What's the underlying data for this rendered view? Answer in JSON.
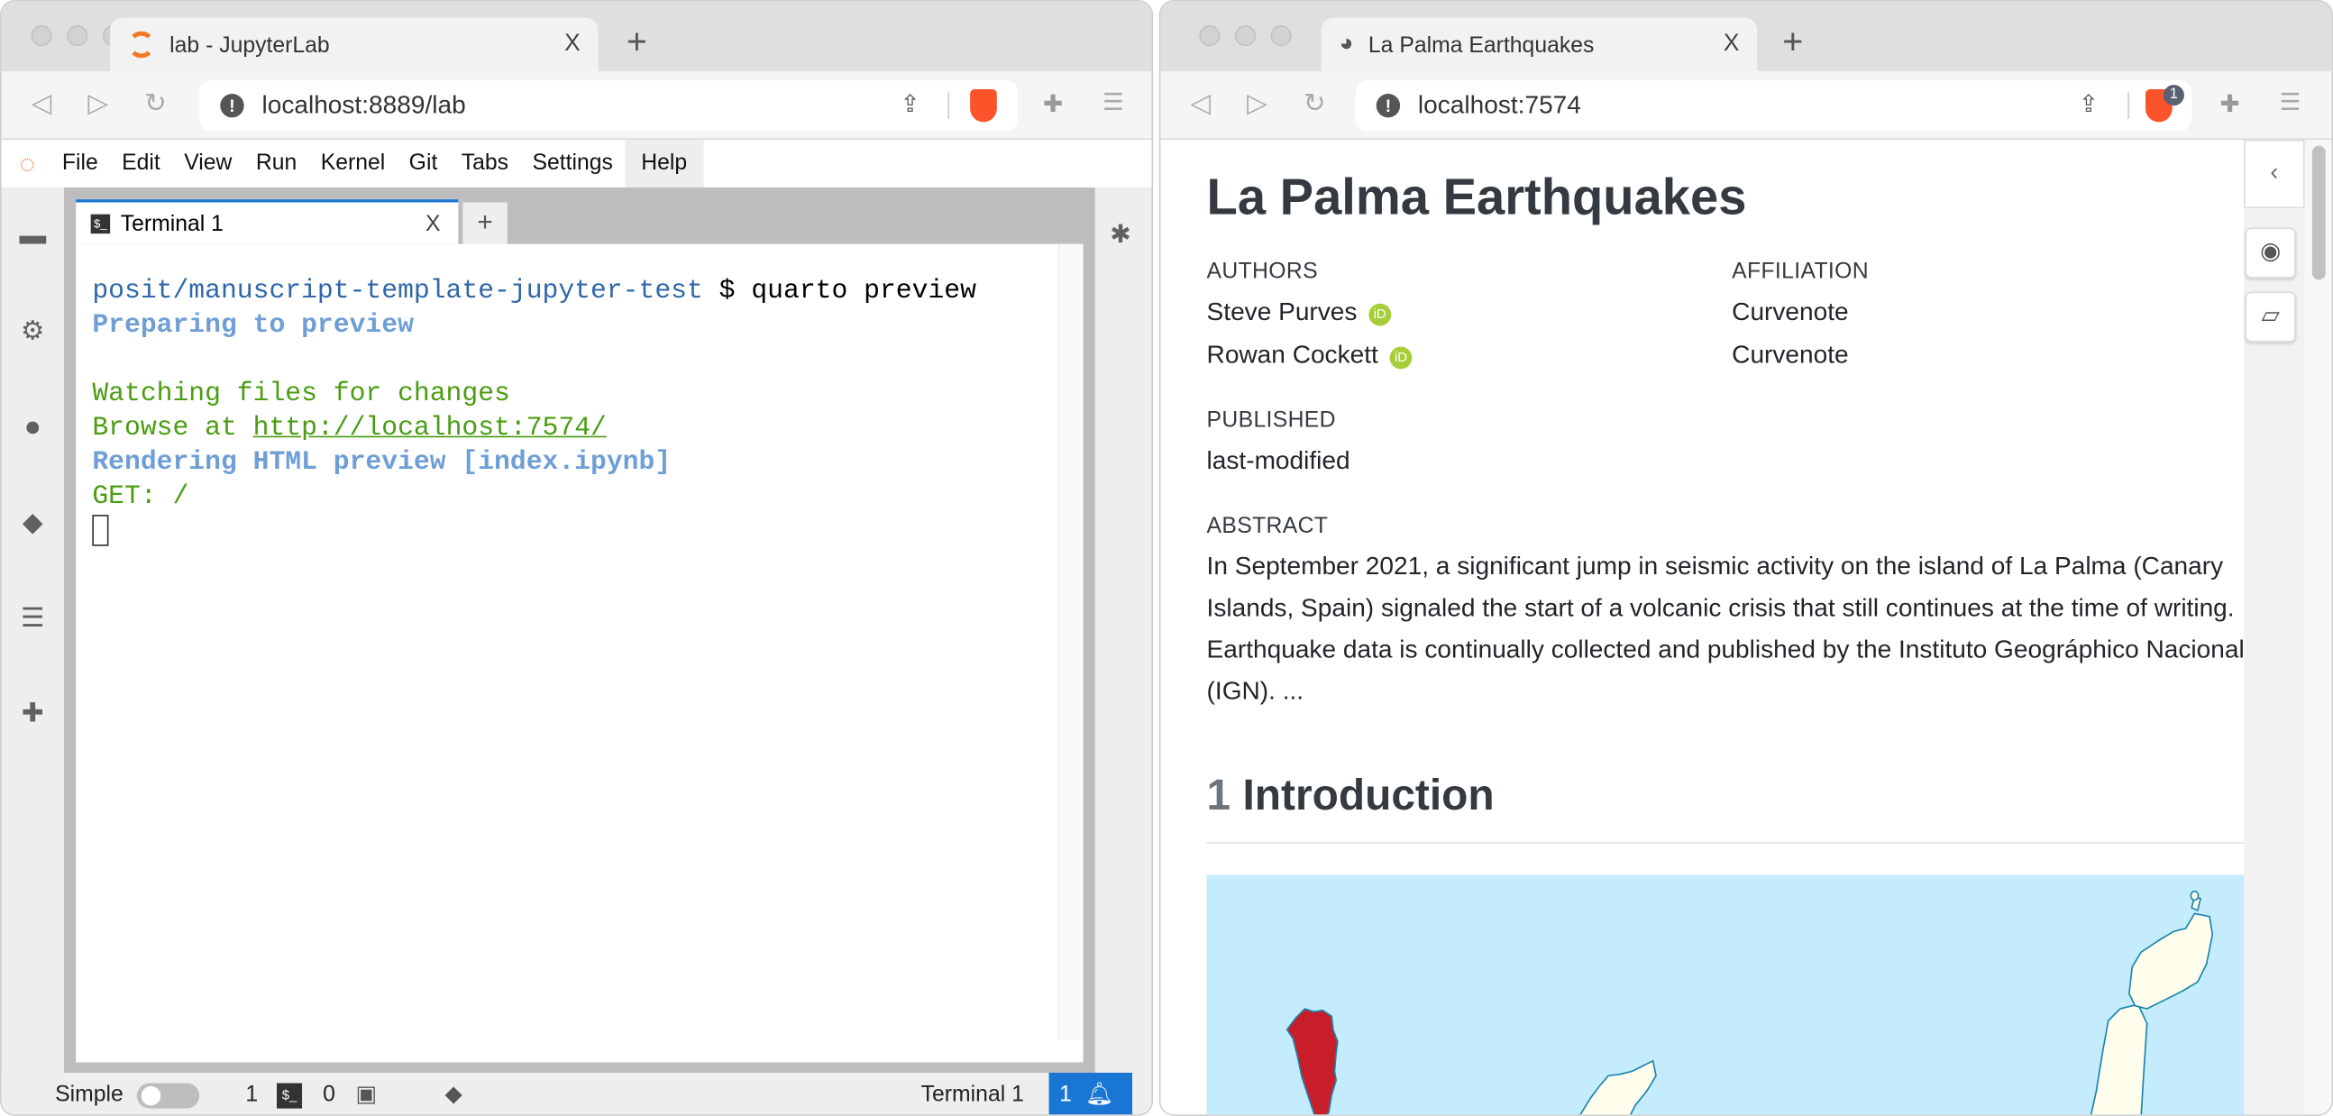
{
  "left_window": {
    "tab_title": "lab - JupyterLab",
    "tab_close": "X",
    "new_tab": "+",
    "url": "localhost:8889/lab",
    "menu": [
      "File",
      "Edit",
      "View",
      "Run",
      "Kernel",
      "Git",
      "Tabs",
      "Settings",
      "Help"
    ],
    "active_menu": "Help",
    "doc_tab": {
      "label": "Terminal 1",
      "close": "X",
      "add": "+"
    },
    "sidebar_icons": [
      "folder-icon",
      "running-icon",
      "stop-icon",
      "git-icon",
      "toc-icon",
      "extension-icon"
    ],
    "terminal": {
      "prompt_path": "posit/manuscript-template-jupyter-test",
      "prompt_symbol": "$",
      "command": "quarto preview",
      "line1": "Preparing to preview",
      "line2": "Watching files for changes",
      "line3_prefix": "Browse at ",
      "line3_link": "http://localhost:7574/",
      "line4": "Rendering HTML preview [index.ipynb]",
      "line5": "GET: /"
    },
    "status": {
      "mode_label": "Simple",
      "simple_mode_on": false,
      "terminals_count": "1",
      "kernels_count": "0",
      "active_item": "Terminal 1",
      "notifications": "1"
    }
  },
  "right_window": {
    "tab_title": "La Palma Earthquakes",
    "tab_close": "X",
    "new_tab": "+",
    "url": "localhost:7574",
    "brave_badge": "1",
    "doc": {
      "title": "La Palma Earthquakes",
      "authors_label": "AUTHORS",
      "affiliation_label": "AFFILIATION",
      "authors": [
        {
          "name": "Steve Purves",
          "affiliation": "Curvenote"
        },
        {
          "name": "Rowan Cockett",
          "affiliation": "Curvenote"
        }
      ],
      "orcid_glyph": "iD",
      "published_label": "PUBLISHED",
      "published": "last-modified",
      "abstract_label": "ABSTRACT",
      "abstract": "In September 2021, a significant jump in seismic activity on the island of La Palma (Canary Islands, Spain) signaled the start of a volcanic crisis that still continues at the time of writing. Earthquake data is continually collected and published by the Instituto Geográphico Nacional (IGN). ...",
      "section_number": "1",
      "section_title": "Introduction"
    },
    "colors": {
      "sea": "#c4ecfc",
      "highlight_island": "#c81e2a",
      "land": "#fffdeb",
      "coast": "#1a83b0"
    }
  }
}
